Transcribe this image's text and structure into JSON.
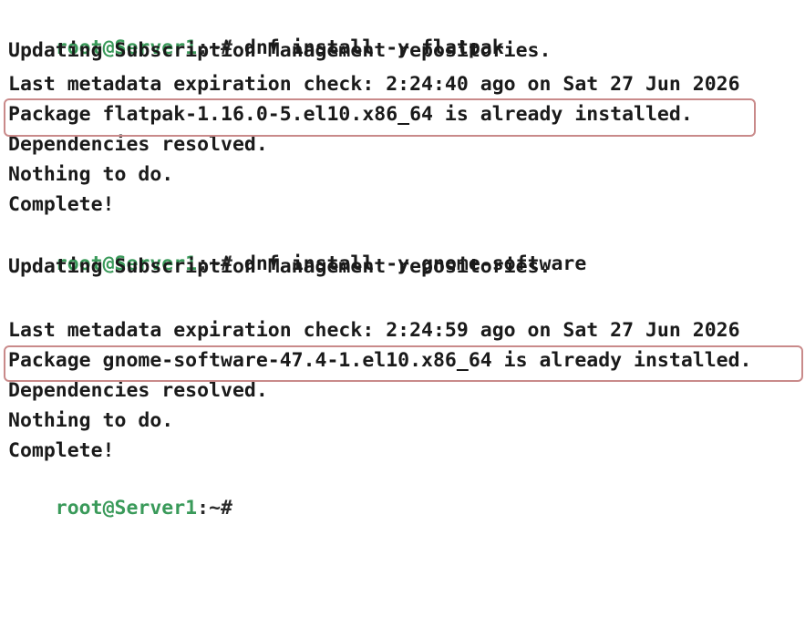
{
  "prompt": {
    "user": "root",
    "at": "@",
    "host": "Server1",
    "path_suffix": ":~#"
  },
  "session": [
    {
      "type": "prompt",
      "command": " dnf install -y flatpak"
    },
    {
      "type": "output",
      "text": "Updating Subscription Management repositories."
    },
    {
      "type": "output",
      "text": "Last metadata expiration check: 2:24:40 ago on Sat 27 Jun 2026"
    },
    {
      "type": "output",
      "text": "Package flatpak-1.16.0-5.el10.x86_64 is already installed.",
      "highlighted": true
    },
    {
      "type": "output",
      "text": "Dependencies resolved."
    },
    {
      "type": "output",
      "text": "Nothing to do."
    },
    {
      "type": "output",
      "text": "Complete!"
    },
    {
      "type": "prompt",
      "command": " dnf install -y gnome-software"
    },
    {
      "type": "output",
      "text": "Updating Subscription Management repositories."
    },
    {
      "type": "output",
      "text": "Last metadata expiration check: 2:24:59 ago on Sat 27 Jun 2026"
    },
    {
      "type": "output",
      "text": "Package gnome-software-47.4-1.el10.x86_64 is already installed.",
      "highlighted": true
    },
    {
      "type": "output",
      "text": "Dependencies resolved."
    },
    {
      "type": "output",
      "text": "Nothing to do."
    },
    {
      "type": "output",
      "text": "Complete!"
    },
    {
      "type": "prompt",
      "command": ""
    }
  ],
  "colors": {
    "prompt_green": "#3a9a5a",
    "highlight_border": "#c98a8a",
    "text": "#1a1a1a",
    "background": "#ffffff"
  }
}
